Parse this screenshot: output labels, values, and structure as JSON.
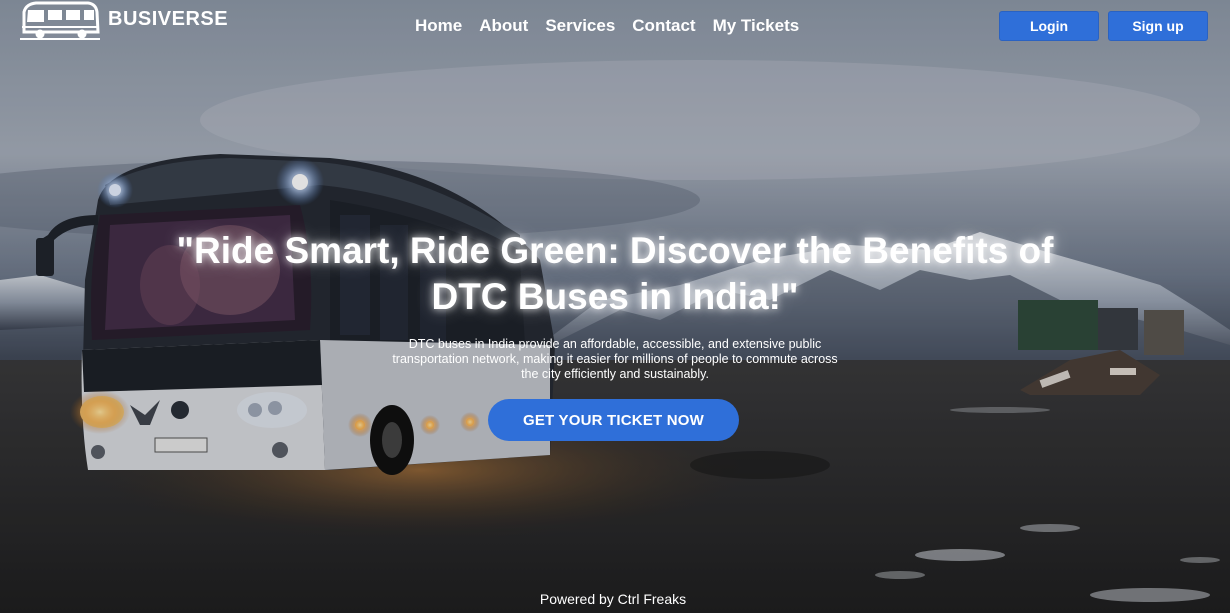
{
  "brand": {
    "name": "BUSIVERSE",
    "logo_icon": "bus-icon"
  },
  "nav": {
    "items": [
      "Home",
      "About",
      "Services",
      "Contact",
      "My Tickets"
    ]
  },
  "auth": {
    "login_label": "Login",
    "signup_label": "Sign up"
  },
  "hero": {
    "title": "\"Ride Smart, Ride Green: Discover the Benefits of DTC Buses in India!\"",
    "description": "DTC buses in India provide an affordable, accessible, and extensive public transportation network, making it easier for millions of people to commute across the city efficiently and sustainably.",
    "cta_label": "GET YOUR TICKET NOW"
  },
  "footer": {
    "text": "Powered by Ctrl Freaks"
  },
  "colors": {
    "accent": "#2f6fd9",
    "text": "#ffffff"
  }
}
